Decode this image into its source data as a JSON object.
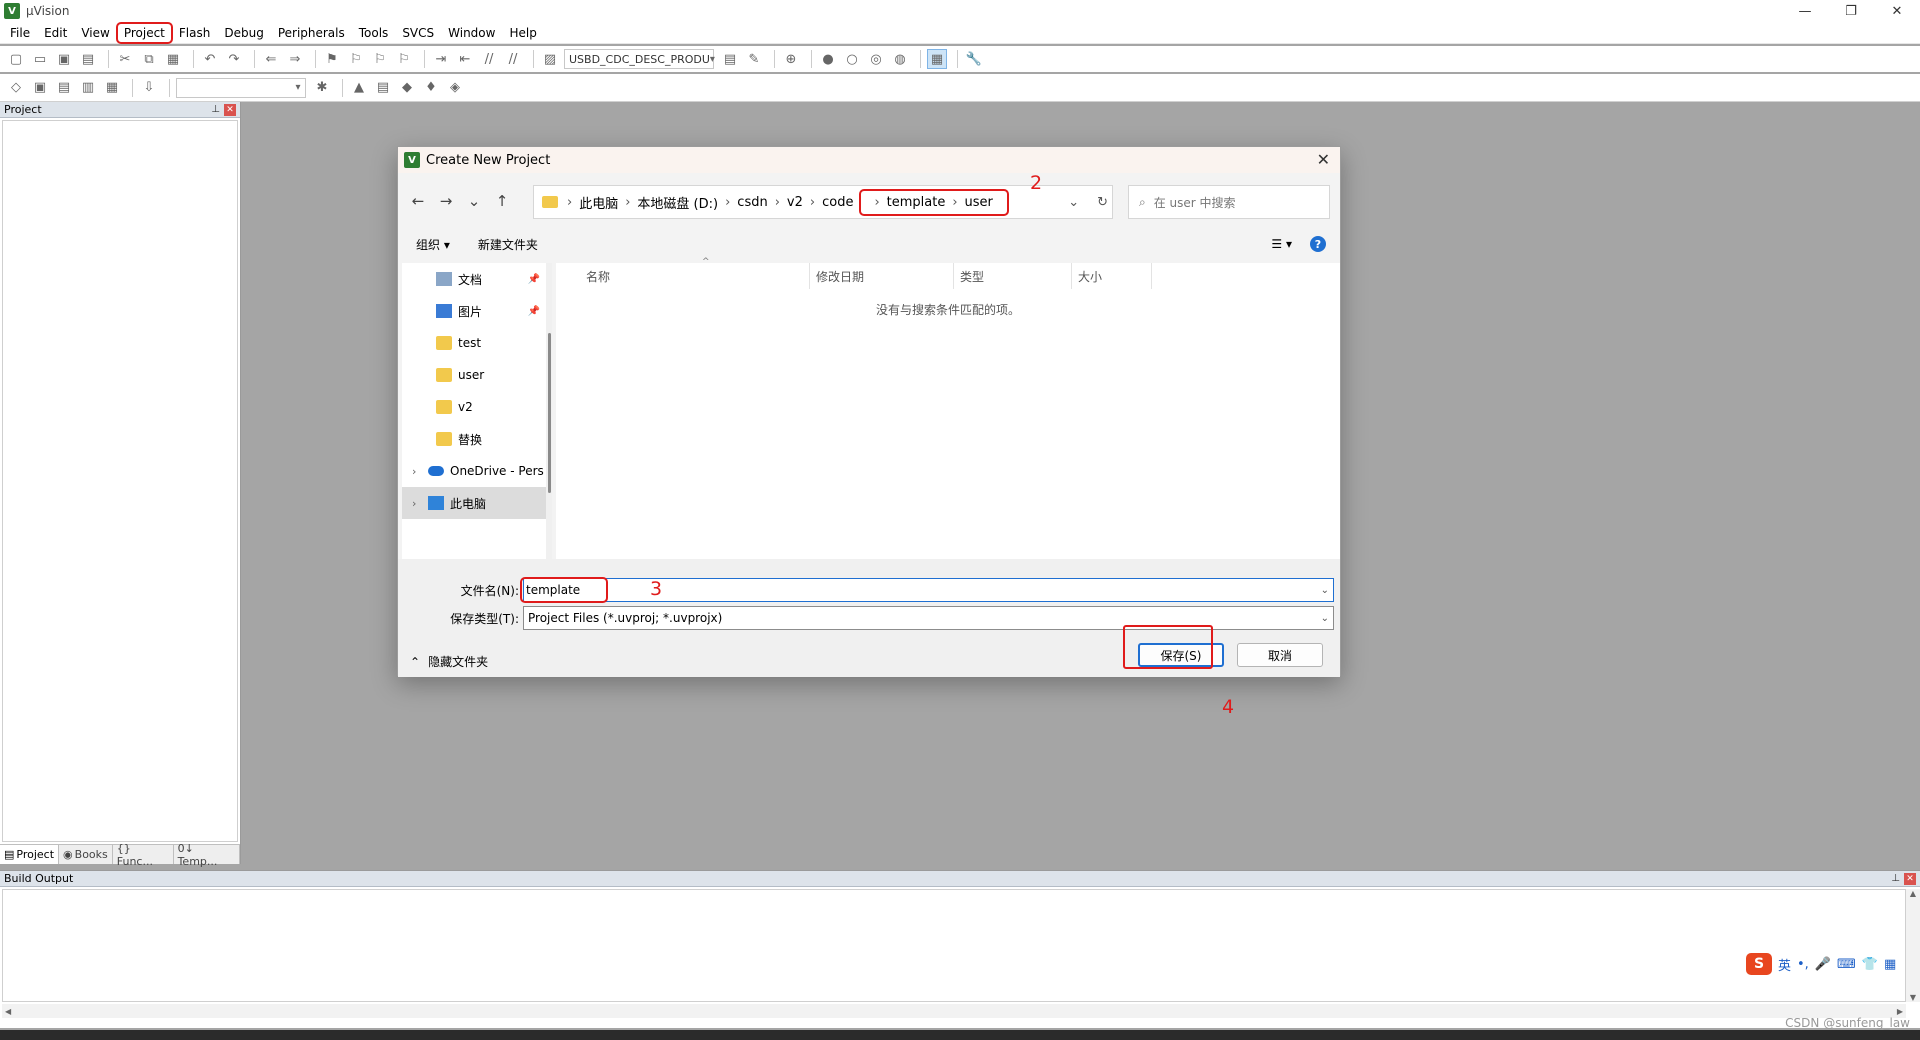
{
  "window": {
    "title": "µVision",
    "min": "—",
    "restore": "❐",
    "close": "✕"
  },
  "menu": [
    "File",
    "Edit",
    "View",
    "Project",
    "Flash",
    "Debug",
    "Peripherals",
    "Tools",
    "SVCS",
    "Window",
    "Help"
  ],
  "toolbar": {
    "target_combo": "USBD_CDC_DESC_PRODU"
  },
  "project_panel": {
    "title": "Project",
    "tabs": [
      "Project",
      "Books",
      "{} Func...",
      "0↓ Temp..."
    ]
  },
  "build_panel": {
    "title": "Build Output"
  },
  "dialog": {
    "title": "Create New Project",
    "breadcrumb": [
      "此电脑",
      "本地磁盘 (D:)",
      "csdn",
      "v2",
      "code"
    ],
    "breadcrumb_highlight": [
      "template",
      "user"
    ],
    "search_placeholder": "在 user 中搜索",
    "organize": "组织 ▾",
    "new_folder": "新建文件夹",
    "nav_items": [
      {
        "label": "文档",
        "icon": "document-icon",
        "pinned": true
      },
      {
        "label": "图片",
        "icon": "pictures-icon",
        "pinned": true
      },
      {
        "label": "test",
        "icon": "folder-icon"
      },
      {
        "label": "user",
        "icon": "folder-icon"
      },
      {
        "label": "v2",
        "icon": "folder-icon"
      },
      {
        "label": "替换",
        "icon": "folder-icon"
      },
      {
        "label": "OneDrive - Pers",
        "icon": "onedrive-icon"
      },
      {
        "label": "此电脑",
        "icon": "this-pc-icon"
      }
    ],
    "columns": [
      "名称",
      "修改日期",
      "类型",
      "大小"
    ],
    "empty_message": "没有与搜索条件匹配的项。",
    "filename_label": "文件名(N):",
    "filename_value": "template",
    "filetype_label": "保存类型(T):",
    "filetype_value": "Project Files (*.uvproj; *.uvprojx)",
    "hide_folders": "隐藏文件夹",
    "save_button": "保存(S)",
    "cancel_button": "取消"
  },
  "annotations": [
    "2",
    "3",
    "4"
  ],
  "ime": {
    "logo": "S",
    "lang": "英"
  },
  "watermark": "CSDN @sunfeng_law"
}
